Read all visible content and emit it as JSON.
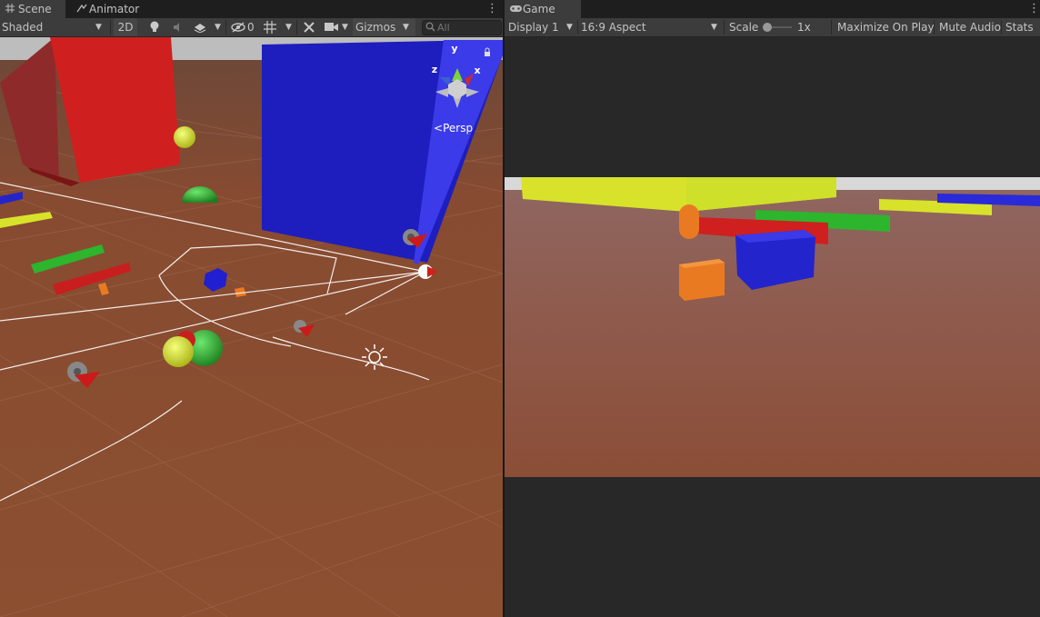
{
  "scene": {
    "tab_label": "Scene",
    "animator_tab_label": "Animator",
    "shading_mode": "Shaded",
    "mode_2d": "2D",
    "hidden_count": "0",
    "gizmos_label": "Gizmos",
    "search_placeholder": "All",
    "axis_y": "y",
    "axis_x": "x",
    "axis_z": "z",
    "projection_label": "Persp"
  },
  "game": {
    "tab_label": "Game",
    "display": "Display 1",
    "aspect": "16:9 Aspect",
    "scale_label": "Scale",
    "scale_value": "1x",
    "maximize_label": "Maximize On Play",
    "mute_label": "Mute Audio",
    "stats_label": "Stats"
  },
  "colors": {
    "editor_bg": "#282828",
    "toolbar_bg": "#3c3c3c",
    "ground": "#8a4a2e",
    "sky": "#c8c8c8",
    "red_cube": "#d01f1f",
    "blue_cube": "#2a2ad8",
    "green": "#2db52d",
    "yellow": "#d8e22a",
    "orange": "#ea7a22"
  },
  "icons": [
    "scene-grid-icon",
    "animator-icon",
    "game-controller-icon",
    "light-bulb-icon",
    "audio-icon",
    "effects-icon",
    "visibility-icon",
    "grid-icon",
    "tools-icon",
    "camera-icon",
    "search-icon",
    "lock-icon",
    "gear-icon",
    "sun-icon"
  ]
}
